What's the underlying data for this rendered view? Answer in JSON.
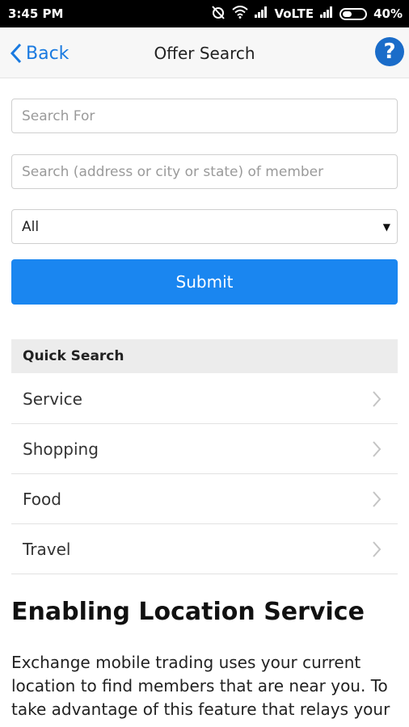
{
  "status_bar": {
    "time": "3:45 PM",
    "network": "VoLTE",
    "battery": "40%"
  },
  "nav": {
    "back_label": "Back",
    "title": "Offer Search"
  },
  "form": {
    "search_for_placeholder": "Search For",
    "location_placeholder": "Search (address or city or state) of member",
    "category_selected": "All",
    "submit_label": "Submit"
  },
  "quick_search": {
    "title": "Quick Search",
    "items": [
      {
        "label": "Service"
      },
      {
        "label": "Shopping"
      },
      {
        "label": "Food"
      },
      {
        "label": "Travel"
      }
    ]
  },
  "info": {
    "heading": "Enabling Location Service",
    "text": "Exchange mobile trading uses your current location to find members that are near you. To take  advantage of this feature that relays your"
  },
  "colors": {
    "accent": "#1a86f0",
    "link": "#1a7ae0",
    "help": "#1a6cc9"
  }
}
